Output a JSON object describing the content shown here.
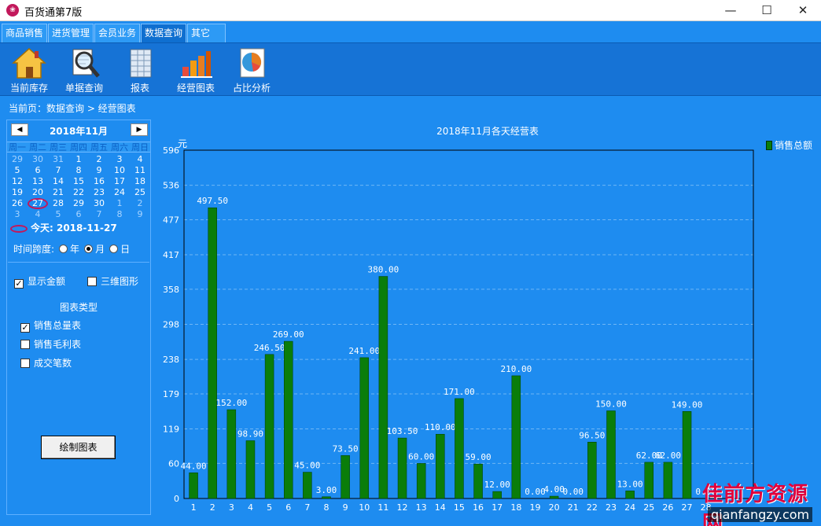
{
  "window": {
    "title": "百货通第7版",
    "minimize": "—",
    "maximize": "☐",
    "close": "✕"
  },
  "tabs": [
    {
      "label": "商品销售"
    },
    {
      "label": "进货管理"
    },
    {
      "label": "会员业务"
    },
    {
      "label": "数据查询"
    },
    {
      "label": "其它"
    }
  ],
  "toolbar": [
    {
      "label": "当前库存",
      "icon": "home-icon"
    },
    {
      "label": "单据查询",
      "icon": "magnifier-document-icon"
    },
    {
      "label": "报表",
      "icon": "report-icon"
    },
    {
      "label": "经营图表",
      "icon": "bar-chart-icon"
    },
    {
      "label": "占比分析",
      "icon": "pie-chart-icon"
    }
  ],
  "breadcrumb": "当前页：数据查询 > 经营图表",
  "calendar": {
    "title": "2018年11月",
    "prev": "◀",
    "next": "▶",
    "weekdays": [
      "周一",
      "周二",
      "周三",
      "周四",
      "周五",
      "周六",
      "周日"
    ],
    "weeks": [
      [
        "29",
        "30",
        "31",
        "1",
        "2",
        "3",
        "4"
      ],
      [
        "5",
        "6",
        "7",
        "8",
        "9",
        "10",
        "11"
      ],
      [
        "12",
        "13",
        "14",
        "15",
        "16",
        "17",
        "18"
      ],
      [
        "19",
        "20",
        "21",
        "22",
        "23",
        "24",
        "25"
      ],
      [
        "26",
        "27",
        "28",
        "29",
        "30",
        "1",
        "2"
      ],
      [
        "3",
        "4",
        "5",
        "6",
        "7",
        "8",
        "9"
      ]
    ],
    "today_label": "今天: 2018-11-27"
  },
  "time_span": {
    "label": "时间跨度:",
    "options": [
      "年",
      "月",
      "日"
    ],
    "selected": "月"
  },
  "options": {
    "show_amount": {
      "label": "显示金额",
      "checked": true
    },
    "three_d": {
      "label": "三维图形",
      "checked": false
    }
  },
  "chart_types": {
    "title": "图表类型",
    "items": [
      {
        "label": "销售总量表",
        "checked": true
      },
      {
        "label": "销售毛利表",
        "checked": false
      },
      {
        "label": "成交笔数",
        "checked": false
      }
    ]
  },
  "draw_button": "绘制图表",
  "watermark": {
    "brand": "佳前方资源网",
    "url": "qianfangzy.com"
  },
  "colors": {
    "background": "#1e8cf0",
    "bar": "#0a7d0a",
    "today_circle": "#c2185b"
  },
  "chart_data": {
    "type": "bar",
    "title": "2018年11月各天经营表",
    "ylabel": "元",
    "xlabel": "",
    "legend": "销售总额",
    "legend_position": "top-right",
    "ylim": [
      0,
      596
    ],
    "yticks": [
      0,
      60,
      119,
      179,
      238,
      298,
      358,
      417,
      477,
      536,
      596
    ],
    "grid": true,
    "categories": [
      "1",
      "2",
      "3",
      "4",
      "5",
      "6",
      "7",
      "8",
      "9",
      "10",
      "11",
      "12",
      "13",
      "14",
      "15",
      "16",
      "17",
      "18",
      "19",
      "20",
      "21",
      "22",
      "23",
      "24",
      "25",
      "26",
      "27",
      "28"
    ],
    "values": [
      44.0,
      497.5,
      152.0,
      98.9,
      246.5,
      269.0,
      45.0,
      3.0,
      73.5,
      241.0,
      380.0,
      103.5,
      60.0,
      110.0,
      171.0,
      59.0,
      12.0,
      210.0,
      0.0,
      4.0,
      0.0,
      96.5,
      150.0,
      13.0,
      62.0,
      62.0,
      149.0,
      0.0
    ],
    "labels": [
      "44.00",
      "497.50",
      "152.00",
      "98.90",
      "246.50",
      "269.00",
      "45.00",
      "3.00",
      "73.50",
      "241.00",
      "380.00",
      "103.50",
      "60.00",
      "110.00",
      "171.00",
      "59.00",
      "12.00",
      "210.00",
      "0.00",
      "4.00",
      "0.00",
      "96.50",
      "150.00",
      "13.00",
      "62.00",
      "62.00",
      "149.00",
      "0.00"
    ]
  }
}
